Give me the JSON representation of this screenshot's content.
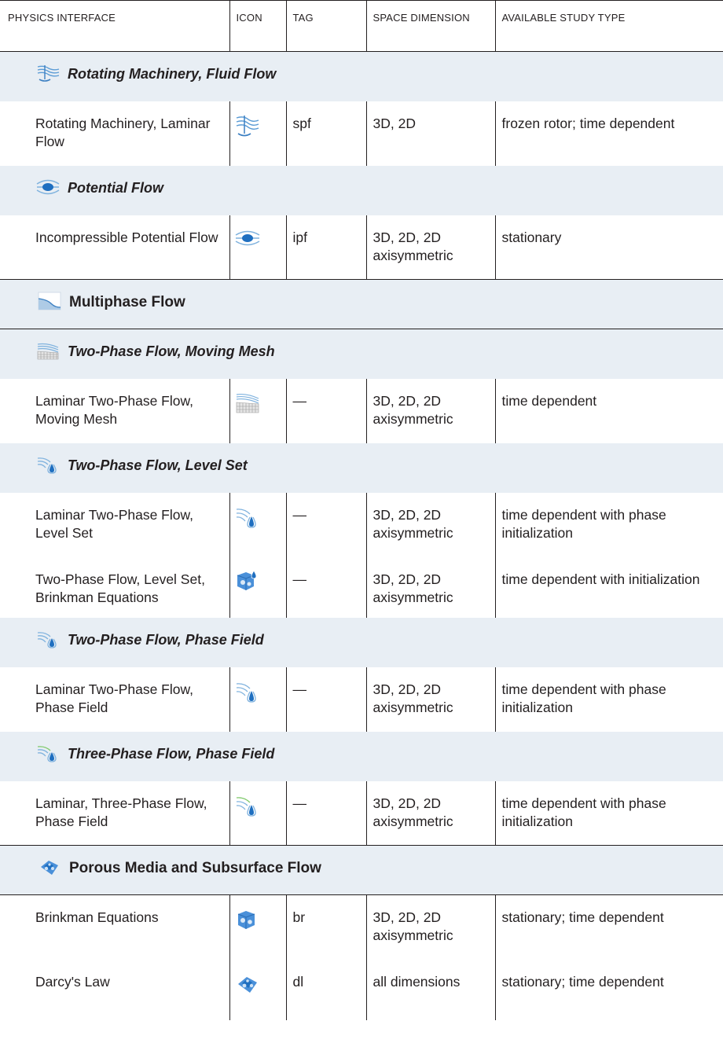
{
  "header": {
    "interface": "PHYSICS INTERFACE",
    "icon": "ICON",
    "tag": "TAG",
    "space": "SPACE DIMENSION",
    "study": "AVAILABLE STUDY TYPE"
  },
  "sections": [
    {
      "title": "Rotating Machinery, Fluid Flow",
      "icon": "rotating-machinery-icon",
      "rows": [
        {
          "name": "Rotating Machinery, Laminar Flow",
          "icon": "rotating-machinery-icon",
          "tag": "spf",
          "space": "3D, 2D",
          "study": "frozen rotor; time dependent"
        }
      ]
    },
    {
      "title": "Potential Flow",
      "icon": "potential-flow-icon",
      "rows": [
        {
          "name": "Incompressible Potential Flow",
          "icon": "potential-flow-icon",
          "tag": "ipf",
          "space": "3D, 2D, 2D axisymmetric",
          "study": "stationary"
        }
      ]
    },
    {
      "title": "Multiphase Flow",
      "icon": "multiphase-flow-icon",
      "rows": []
    },
    {
      "title": "Two-Phase Flow, Moving Mesh",
      "icon": "moving-mesh-icon",
      "rows": [
        {
          "name": "Laminar Two-Phase Flow, Moving Mesh",
          "icon": "moving-mesh-icon",
          "tag": "—",
          "space": "3D, 2D, 2D axisymmetric",
          "study": "time dependent"
        }
      ]
    },
    {
      "title": "Two-Phase Flow, Level Set",
      "icon": "level-set-icon",
      "rows": [
        {
          "name": "Laminar Two-Phase Flow, Level Set",
          "icon": "level-set-icon",
          "tag": "—",
          "space": "3D, 2D, 2D axisymmetric",
          "study": "time dependent with phase initialization"
        },
        {
          "name": "Two-Phase Flow, Level Set, Brinkman Equations",
          "icon": "level-set-brinkman-icon",
          "tag": "—",
          "space": "3D, 2D, 2D axisymmetric",
          "study": "time dependent with initialization"
        }
      ]
    },
    {
      "title": "Two-Phase Flow, Phase Field",
      "icon": "phase-field-icon",
      "rows": [
        {
          "name": "Laminar Two-Phase Flow, Phase Field",
          "icon": "phase-field-icon",
          "tag": "—",
          "space": "3D, 2D, 2D axisymmetric",
          "study": "time dependent with phase initialization"
        }
      ]
    },
    {
      "title": "Three-Phase Flow, Phase Field",
      "icon": "three-phase-flow-icon",
      "rows": [
        {
          "name": "Laminar, Three-Phase Flow, Phase Field",
          "icon": "three-phase-flow-icon",
          "tag": "—",
          "space": "3D, 2D, 2D axisymmetric",
          "study": "time dependent with phase initialization"
        }
      ]
    },
    {
      "title": "Porous Media and Subsurface Flow",
      "icon": "porous-media-icon",
      "rows": [
        {
          "name": "Brinkman Equations",
          "icon": "brinkman-icon",
          "tag": "br",
          "space": "3D, 2D, 2D axisymmetric",
          "study": "stationary; time dependent"
        },
        {
          "name": "Darcy's Law",
          "icon": "darcy-law-icon",
          "tag": "dl",
          "space": "all dimensions",
          "study": "stationary; time dependent"
        }
      ]
    }
  ]
}
